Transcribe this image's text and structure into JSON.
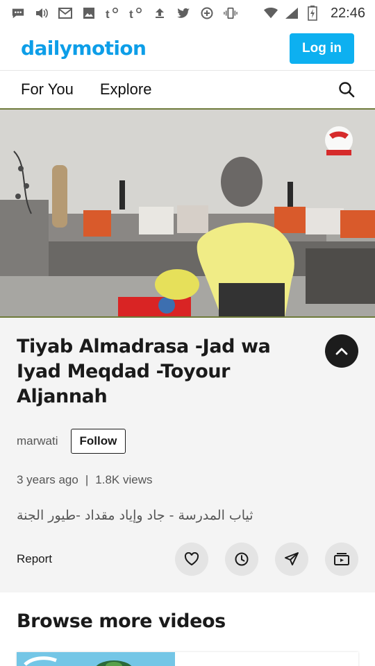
{
  "status_bar": {
    "icons": [
      "message-icon",
      "volume-icon",
      "gmail-icon",
      "image-icon",
      "t-notify-icon",
      "t-notify-icon",
      "upload-icon",
      "twitter-icon",
      "data-saver-icon",
      "vibrate-icon",
      "wifi-icon",
      "signal-icon",
      "battery-icon"
    ],
    "time": "22:46"
  },
  "header": {
    "logo": "dailymotion",
    "login_label": "Log in",
    "accent_color": "#0db0f0"
  },
  "nav": {
    "tabs": [
      {
        "label": "For You"
      },
      {
        "label": "Explore"
      }
    ]
  },
  "video": {
    "title": "Tiyab Almadrasa -Jad wa Iyad Meqdad -Toyour Aljannah",
    "channel": "marwati",
    "follow_label": "Follow",
    "age": "3 years ago",
    "views": "1.8K views",
    "description": "ثياب المدرسة - جاد وإياد مقداد -طيور الجنة",
    "report_label": "Report"
  },
  "browse": {
    "title": "Browse more videos"
  }
}
